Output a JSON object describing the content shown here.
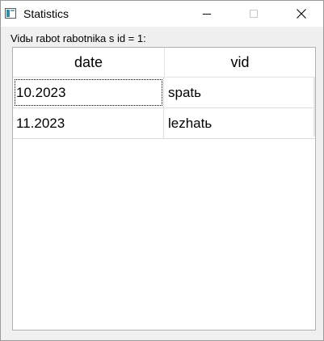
{
  "window": {
    "title": "Statistics"
  },
  "caption": "Vidы rabot rabotnika s id = 1:",
  "table": {
    "columns": [
      "date",
      "vid"
    ],
    "rows": [
      {
        "date": "10.2023",
        "vid": "spatь"
      },
      {
        "date": "11.2023",
        "vid": "lezhatь"
      }
    ]
  }
}
